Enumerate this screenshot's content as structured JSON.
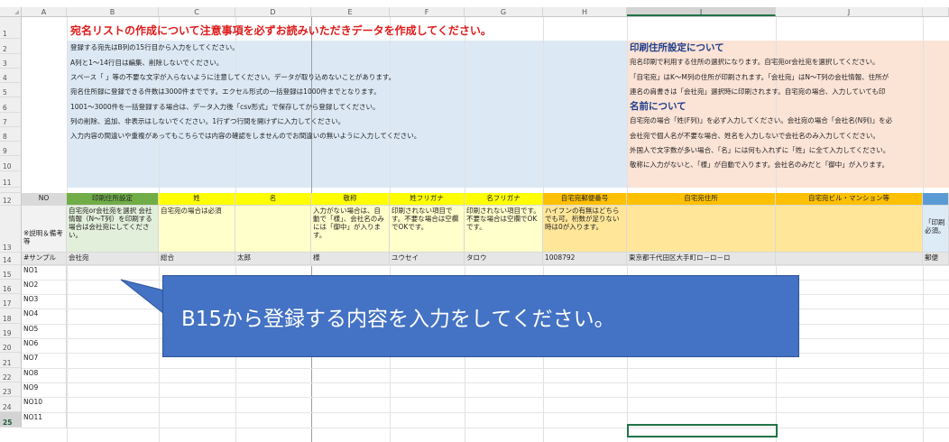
{
  "sheet": {
    "columns": [
      "A",
      "B",
      "C",
      "D",
      "E",
      "F",
      "G",
      "H",
      "I",
      "J"
    ],
    "selected_column": "I",
    "rows": [
      "1",
      "2",
      "3",
      "4",
      "5",
      "6",
      "7",
      "8",
      "9",
      "10",
      "11",
      "12",
      "13",
      "14",
      "15",
      "16",
      "17",
      "18",
      "19",
      "20",
      "21",
      "22",
      "23",
      "24",
      "25"
    ],
    "selected_row": "25"
  },
  "title": "宛名リストの作成について注意事項を必ずお読みいただきデータを作成してください。",
  "notes": [
    "登録する宛先はB列の15行目から入力をしてください。",
    "A列と1〜14行目は編集、削除しないでください。",
    "スペース「 」等の不要な文字が入らないように注意してください。データが取り込めないことがあります。",
    "宛名住所録に登録できる件数は3000件までです。エクセル形式の一括登録は1000件までとなります。",
    "1001〜3000件を一括登録する場合は、データ入力後「csv形式」で保存してから登録してください。",
    "列の削除、追加、非表示はしないでください。1行ずつ行間を開けずに入力してください。",
    "入力内容の間違いや重複があってもこちらでは内容の確認をしませんのでお間違いの無いように入力してください。"
  ],
  "side": {
    "heading1": "印刷住所設定について",
    "lines1": [
      "宛名印刷で利用する住所の選択になります。自宅宛or会社宛を選択してください。",
      "「自宅宛」はK〜M列の住所が印刷されます。「会社宛」はN〜T列の会社情報、住所が",
      "連名の肩書きは「会社宛」選択時に印刷されます。自宅宛の場合、入力していても印"
    ],
    "heading2": "名前について",
    "lines2": [
      "自宅宛の場合「姓(F列)」を必ず入力してください。会社宛の場合「会社名(N列)」を必",
      "会社宛で個人名が不要な場合、姓名を入力しないで会社名のみ入力してください。",
      "外国人で文字数が多い場合、「名」には何も入れずに「姓」に全て入力してください。",
      "敬称に入力がないと、「様」が自動で入ります。会社名のみだと「御中」が入ります。"
    ]
  },
  "headers": {
    "a": "NO",
    "b": "印刷住所設定",
    "c": "姓",
    "d": "名",
    "e": "敬称",
    "f": "姓フリガナ",
    "g": "名フリガナ",
    "h": "自宅宛郵便番号",
    "i": "自宅宛住所",
    "j": "自宅宛ビル・マンション等"
  },
  "descriptions": {
    "a": "※説明＆備考等",
    "b": "自宅宛or会社宛を選択\n会社情報（N〜T列）を印刷する場合は会社宛にしてください。",
    "c": "自宅宛の場合は必須",
    "e": "入力がない場合は、自動で「様」、会社名のみには「御中」が入ります。",
    "f": "印刷されない項目です。不要な場合は空欄でOKです。",
    "g": "印刷されない項目です。不要な場合は空欄でOKです。",
    "h": "ハイフンの有無はどちらでも可。桁数が足りない時は0が入ります。",
    "k_partial": "「印刷\n必須。"
  },
  "sample": {
    "a": "#サンプル",
    "b": "会社宛",
    "c": "総合",
    "d": "太郎",
    "e": "様",
    "f": "ユウセイ",
    "g": "タロウ",
    "h": "1008792",
    "i": "東京都千代田区大手町ロ－ロ－ロ",
    "k_partial": "郵便"
  },
  "numbers": [
    "NO1",
    "NO2",
    "NO3",
    "NO4",
    "NO5",
    "NO6",
    "NO7",
    "NO8",
    "NO9",
    "NO10",
    "NO11"
  ],
  "callout": "B15から登録する内容を入力をしてください。",
  "colors": {
    "title_red": "#e01a1a",
    "green_header": "#70ad47",
    "yellow_header": "#ffff00",
    "orange_header": "#ffc000",
    "blue_header": "#5b9bd5",
    "callout_blue": "#4472c4",
    "excel_green": "#217346"
  }
}
